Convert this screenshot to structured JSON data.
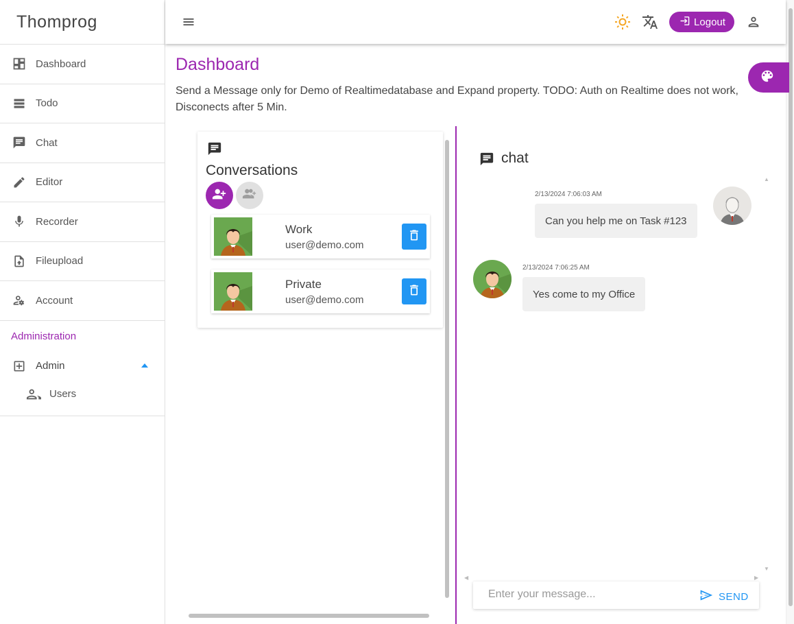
{
  "app": {
    "brand": "Thomprog"
  },
  "sidebar": {
    "items": [
      {
        "label": "Dashboard",
        "icon": "dashboard-icon"
      },
      {
        "label": "Todo",
        "icon": "list-icon"
      },
      {
        "label": "Chat",
        "icon": "chat-icon"
      },
      {
        "label": "Editor",
        "icon": "pencil-icon"
      },
      {
        "label": "Recorder",
        "icon": "microphone-icon"
      },
      {
        "label": "Fileupload",
        "icon": "file-upload-icon"
      },
      {
        "label": "Account",
        "icon": "account-settings-icon"
      }
    ],
    "admin_heading": "Administration",
    "admin_label": "Admin",
    "users_label": "Users"
  },
  "header": {
    "logout_label": "Logout",
    "icons": [
      "menu-icon",
      "sun-icon",
      "translate-icon",
      "logout-icon",
      "user-icon"
    ]
  },
  "page": {
    "title": "Dashboard",
    "description": "Send a Message only for Demo of Realtimedatabase and Expand property. TODO: Auth on Realtime does not work, Disconects after 5 Min."
  },
  "conversations": {
    "title": "Conversations",
    "items": [
      {
        "name": "Work",
        "email": "user@demo.com"
      },
      {
        "name": "Private",
        "email": "user@demo.com"
      }
    ]
  },
  "chat": {
    "title": "chat",
    "messages": [
      {
        "time": "2/13/2024 7:06:03 AM",
        "text": "Can you help me on Task #123",
        "side": "right"
      },
      {
        "time": "2/13/2024 7:06:25 AM",
        "text": "Yes come to my Office",
        "side": "left"
      }
    ],
    "input_placeholder": "Enter your message...",
    "send_label": "SEND"
  },
  "colors": {
    "accent": "#9c27b0",
    "primary": "#2196f3",
    "sun": "#f5a623"
  }
}
